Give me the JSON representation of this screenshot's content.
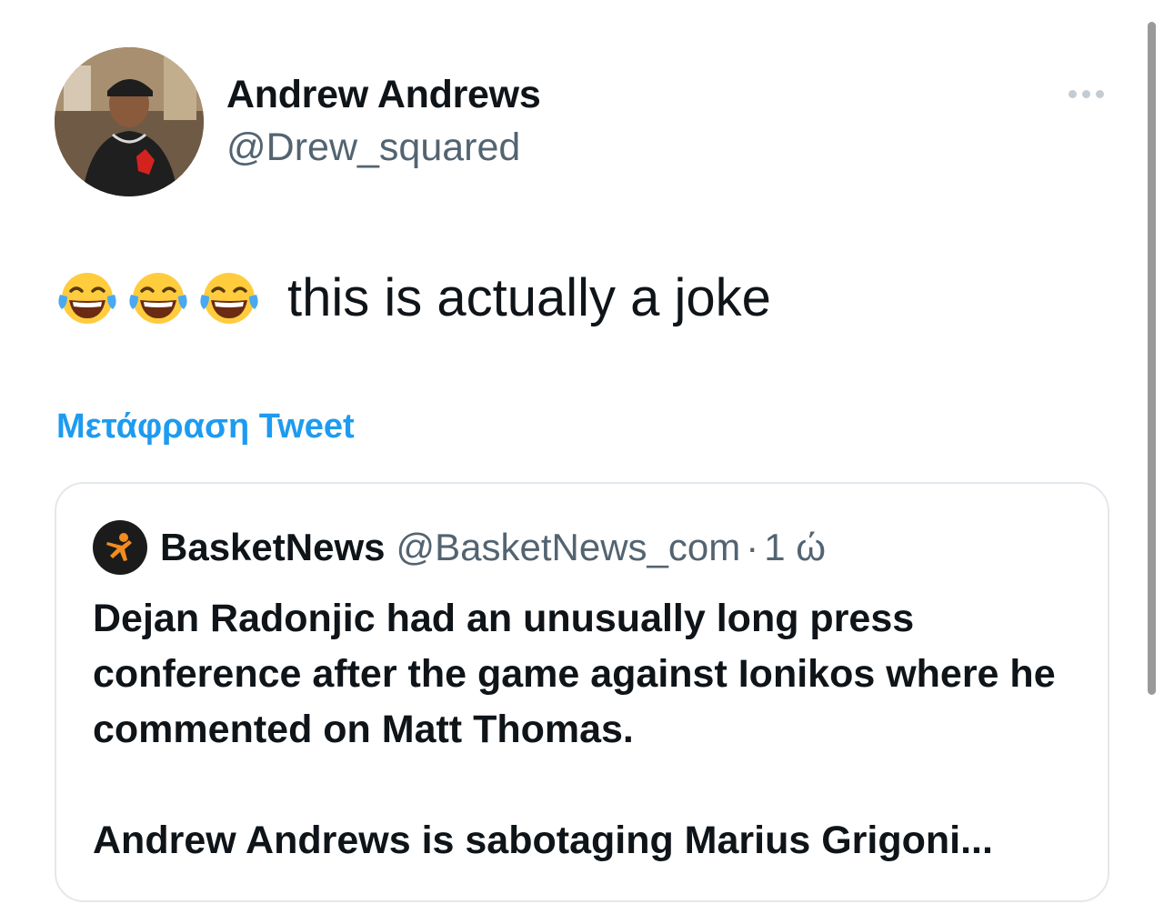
{
  "author": {
    "display_name": "Andrew Andrews",
    "handle": "@Drew_squared"
  },
  "tweet": {
    "emojis": [
      "face-with-tears-of-joy-icon",
      "face-with-tears-of-joy-icon",
      "face-with-tears-of-joy-icon"
    ],
    "text": "this is actually a joke",
    "translate_label": "Μετάφραση Tweet"
  },
  "quote": {
    "name": "BasketNews",
    "handle": "@BasketNews_com",
    "separator": "·",
    "time": "1 ώ",
    "paragraph1": "Dejan Radonjic had an unusually long press conference after the game against Ionikos where he commented on Matt Thomas.",
    "paragraph2": "Andrew Andrews is sabotaging Marius Grigoni..."
  },
  "colors": {
    "accent": "#1d9bf0",
    "secondary_text": "#536471",
    "primary_text": "#0f1419",
    "border": "#e3e8ec"
  }
}
